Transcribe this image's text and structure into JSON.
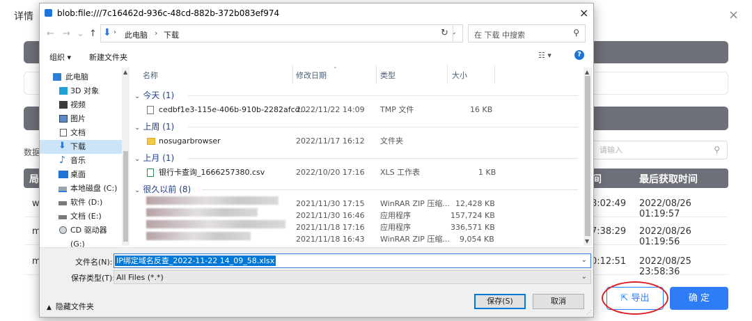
{
  "background": {
    "title": "详情",
    "close": "×",
    "label_fragment": "数据",
    "search_placeholder": "请输入",
    "table_header_fragment": "局",
    "table_header_col_a": "间",
    "table_header_col_b": "最后获取时间",
    "rows": [
      {
        "c1": "w",
        "c2": "8:02:49",
        "c3": "2022/08/26 01:19:57"
      },
      {
        "c1": "m",
        "c2": "7:38:29",
        "c3": "2022/08/26 01:19:56"
      },
      {
        "c1": "m",
        "c2": "0:12:51",
        "c3": "2022/08/25 23:58:36"
      }
    ],
    "export_label": "导出",
    "ok_label": "确 定",
    "colors": {
      "accent": "#2e7cf6",
      "bar": "#6e7079",
      "highlight_ring": "#e02020"
    }
  },
  "dialog": {
    "title": "blob:file:///7c16462d-936c-48cd-882b-372b083ef974",
    "close": "×",
    "nav": {
      "back": "←",
      "forward": "→",
      "recent": "⌄",
      "up": "↑"
    },
    "address": {
      "seg1": "此电脑",
      "sep": "›",
      "seg2": "下载",
      "dropdown": "⌄"
    },
    "refresh": "↻",
    "search_placeholder": "在 下载 中搜索",
    "toolbar": {
      "organize": "组织 ▾",
      "new_folder": "新建文件夹",
      "view": "☷ ▾",
      "help": "?"
    },
    "tree": [
      {
        "label": "此电脑",
        "icon": "computer-icon"
      },
      {
        "label": "3D 对象",
        "icon": "cube-icon"
      },
      {
        "label": "视频",
        "icon": "video-icon"
      },
      {
        "label": "图片",
        "icon": "picture-icon"
      },
      {
        "label": "文档",
        "icon": "document-icon"
      },
      {
        "label": "下载",
        "icon": "download-icon"
      },
      {
        "label": "音乐",
        "icon": "music-icon"
      },
      {
        "label": "桌面",
        "icon": "desktop-icon"
      },
      {
        "label": "本地磁盘 (C:)",
        "icon": "drive-icon"
      },
      {
        "label": "软件 (D:)",
        "icon": "drive-icon"
      },
      {
        "label": "文档 (E:)",
        "icon": "drive-icon"
      },
      {
        "label": "CD 驱动器 (G:)",
        "icon": "cd-icon"
      }
    ],
    "columns": {
      "name": "名称",
      "date": "修改日期",
      "type": "类型",
      "size": "大小"
    },
    "groups": [
      {
        "label": "今天 (1)"
      },
      {
        "label": "上周 (1)"
      },
      {
        "label": "上月 (1)"
      },
      {
        "label": "很久以前 (8)"
      }
    ],
    "files": [
      {
        "name": "cedbf1e3-115e-406b-910b-2282afcd...",
        "date": "2022/11/22 14:09",
        "type": "TMP 文件",
        "size": "16 KB",
        "icon": "file-icon"
      },
      {
        "name": "nosugarbrowser",
        "date": "2022/11/17 16:12",
        "type": "文件夹",
        "size": "",
        "icon": "folder-icon"
      },
      {
        "name": "银行卡查询_1666257380.csv",
        "date": "2022/10/20 17:16",
        "type": "XLS 工作表",
        "size": "1 KB",
        "icon": "excel-icon"
      },
      {
        "name": "",
        "date": "2021/11/30 17:15",
        "type": "WinRAR ZIP 压缩...",
        "size": "12,428 KB",
        "icon": ""
      },
      {
        "name": "",
        "date": "2021/11/30 16:46",
        "type": "应用程序",
        "size": "157,724 KB",
        "icon": ""
      },
      {
        "name": "",
        "date": "2021/11/18 17:16",
        "type": "应用程序",
        "size": "336,571 KB",
        "icon": ""
      },
      {
        "name": "",
        "date": "2021/11/18 16:43",
        "type": "WinRAR ZIP 压缩...",
        "size": "9,054 KB",
        "icon": ""
      }
    ],
    "filename_label": "文件名(N):",
    "filename_value": "IP绑定域名反查_2022-11-22 14_09_58.xlsx",
    "filetype_label": "保存类型(T):",
    "filetype_value": "All Files (*.*)",
    "hide_folders": "隐藏文件夹",
    "save_label": "保存(S)",
    "cancel_label": "取消"
  }
}
